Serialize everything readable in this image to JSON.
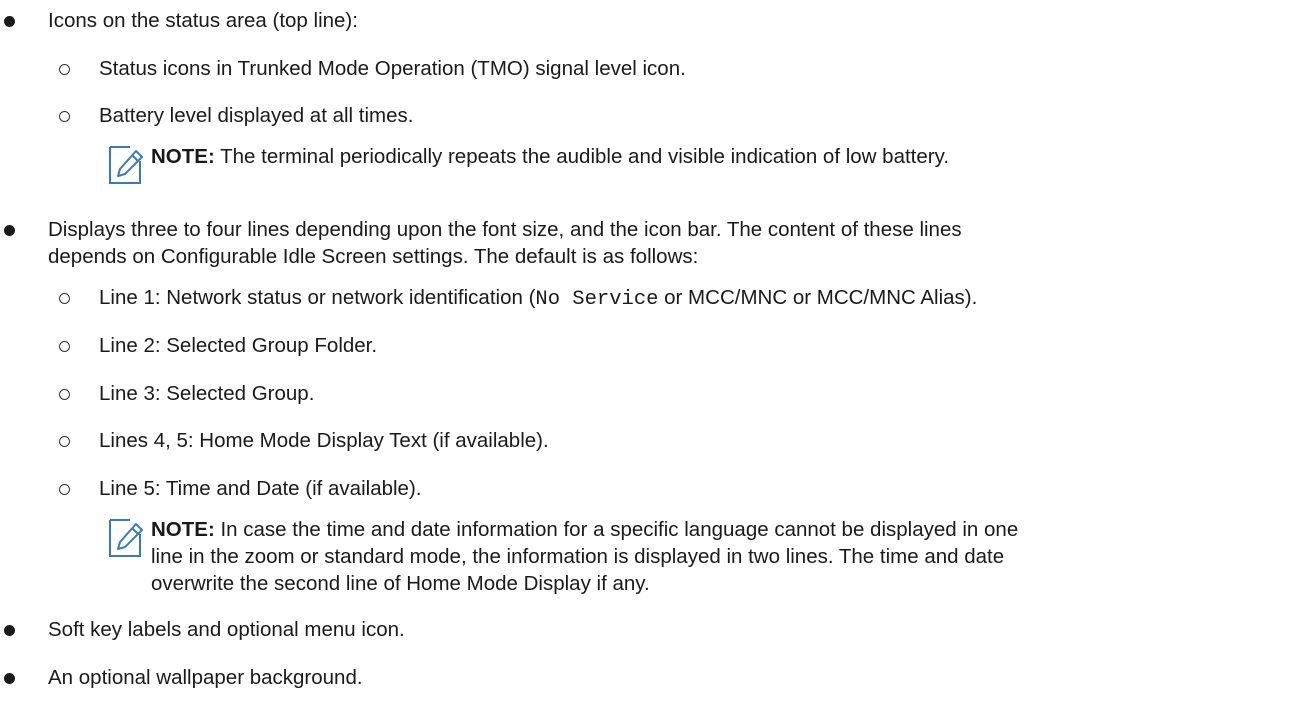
{
  "items": [
    {
      "level": 1,
      "text": "Icons on the status area (top line):"
    },
    {
      "level": 2,
      "text": "Status icons in Trunked Mode Operation (TMO) signal level icon."
    },
    {
      "level": 2,
      "text": "Battery level displayed at all times."
    },
    {
      "note_label": "NOTE:",
      "note_text": "The terminal periodically repeats the audible and visible indication of low battery."
    },
    {
      "level": 1,
      "text": "Displays three to four lines depending upon the font size, and the icon bar. The content of these lines",
      "text_cont": "depends on Configurable Idle Screen settings. The default is as follows:"
    },
    {
      "level": 2,
      "text_pre": "Line 1: Network status or network identification (",
      "code": "No Service",
      "text_post": " or MCC/MNC or MCC/MNC Alias)."
    },
    {
      "level": 2,
      "text": "Line 2: Selected Group Folder."
    },
    {
      "level": 2,
      "text": "Line 3: Selected Group."
    },
    {
      "level": 2,
      "text": "Lines 4, 5: Home Mode Display Text (if available)."
    },
    {
      "level": 2,
      "text": "Line 5: Time and Date (if available)."
    },
    {
      "note_label": "NOTE:",
      "note_line1": "In case the time and date information for a specific language cannot be displayed in one",
      "note_line2": "line in the zoom or standard mode, the information is displayed in two lines. The time and date",
      "note_line3": "overwrite the second line of Home Mode Display if any."
    },
    {
      "level": 1,
      "text": "Soft key labels and optional menu icon."
    },
    {
      "level": 1,
      "text": "An optional wallpaper background."
    }
  ],
  "icons": {
    "bullet": "filled-circle-bullet",
    "sub_bullet": "hollow-circle-bullet",
    "note": "note-pencil-icon"
  }
}
